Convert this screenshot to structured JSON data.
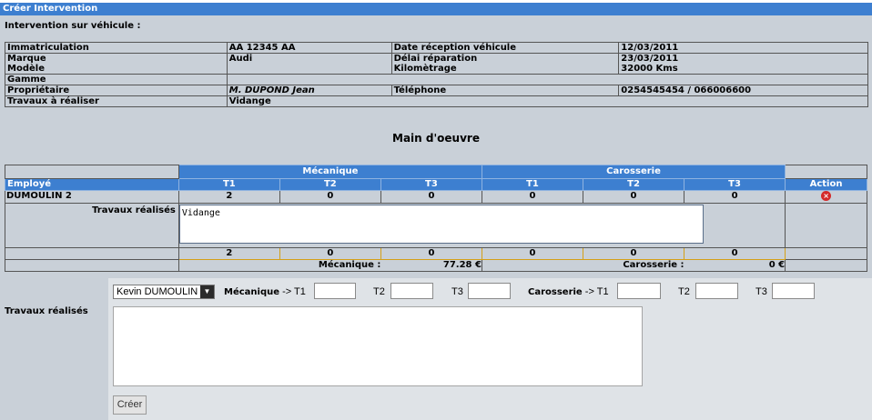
{
  "window_title": "Créer Intervention",
  "subtitle": "Intervention sur véhicule :",
  "vehicle": {
    "immat_label": "Immatriculation",
    "immat_value": "AA 12345 AA",
    "date_label": "Date réception véhicule",
    "date_value": "12/03/2011",
    "marque_label": "Marque",
    "marque_value": "Audi",
    "delai_label": "Délai réparation",
    "delai_value": "23/03/2011",
    "modele_label": "Modèle",
    "km_label": "Kilomètrage",
    "km_value": "32000 Kms",
    "gamme_label": "Gamme",
    "proprio_label": "Propriétaire",
    "proprio_value": "M. DUPOND Jean",
    "tel_label": "Téléphone",
    "tel_value": "0254545454 / 066006600",
    "travaux_label": "Travaux à réaliser",
    "travaux_value": "Vidange"
  },
  "main_oeuvre_title": "Main d'oeuvre",
  "labor": {
    "mecanique_header": "Mécanique",
    "carosserie_header": "Carosserie",
    "employe_header": "Employé",
    "action_header": "Action",
    "col_headers": [
      "T1",
      "T2",
      "T3",
      "T1",
      "T2",
      "T3"
    ],
    "row": {
      "employee": "DUMOULIN 2",
      "values": [
        "2",
        "0",
        "0",
        "0",
        "0",
        "0"
      ]
    },
    "travaux_label": "Travaux réalisés",
    "travaux_text": "Vidange",
    "totals": [
      "2",
      "0",
      "0",
      "0",
      "0",
      "0"
    ],
    "mecanique_total_label": "Mécanique :",
    "mecanique_total_value": "77.28 €",
    "carosserie_total_label": "Carosserie :",
    "carosserie_total_value": "0 €"
  },
  "form": {
    "employee_selected": "Kevin DUMOULIN",
    "mecanique_label": "Mécanique",
    "mecanique_t1": "-> T1",
    "t2": "T2",
    "t3": "T3",
    "carosserie_label": "Carosserie",
    "carosserie_t1": "-> T1",
    "travaux_label": "Travaux réalisés",
    "submit_label": "Créer"
  },
  "icons": {
    "delete": "delete-icon",
    "dropdown": "chevron-down-icon"
  },
  "colors": {
    "accent": "#3d7fd0",
    "panel": "#c9d0d8",
    "delete": "#d42a2a"
  }
}
